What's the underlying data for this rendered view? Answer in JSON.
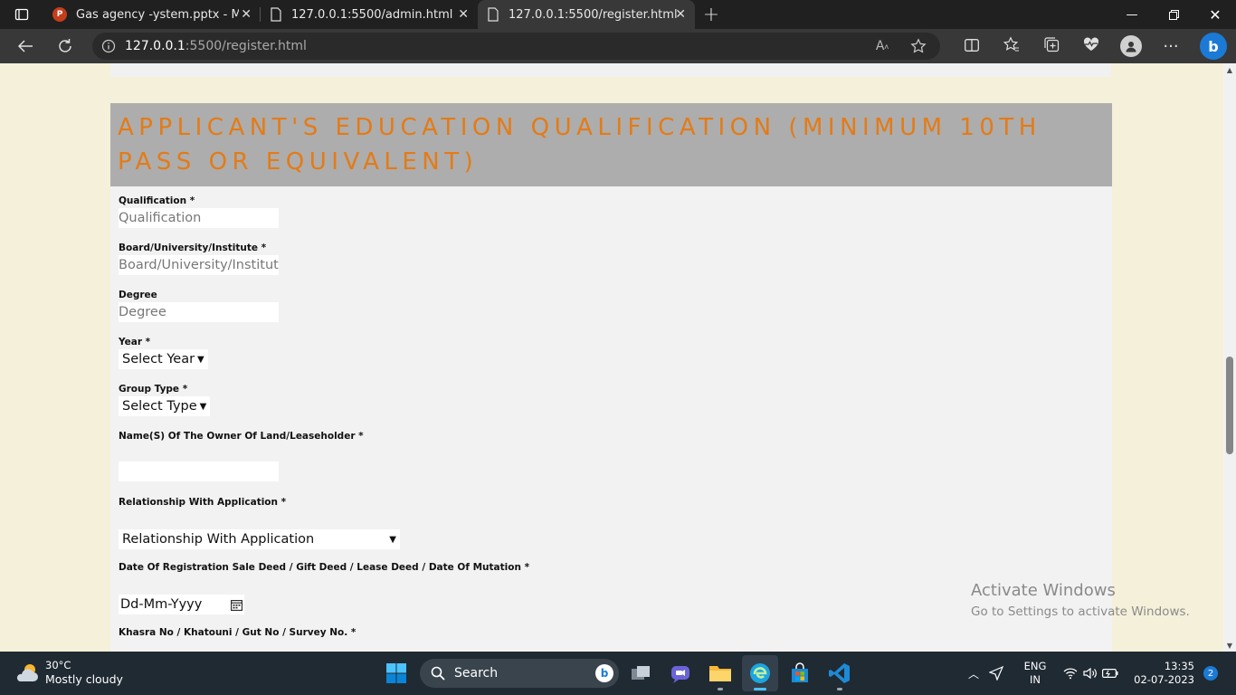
{
  "tabs": [
    {
      "title": "Gas agency -ystem.pptx - Micros",
      "icon": "powerpoint-icon",
      "active": false
    },
    {
      "title": "127.0.0.1:5500/admin.html",
      "icon": "page-icon",
      "active": false
    },
    {
      "title": "127.0.0.1:5500/register.html",
      "icon": "page-icon",
      "active": true
    }
  ],
  "address_bar": {
    "host": "127.0.0.1",
    "path": ":5500/register.html"
  },
  "section": {
    "heading": "Applicant's Education Qualification (Minimum 10th Pass Or Equivalent)"
  },
  "form": {
    "qualification": {
      "label": "Qualification *",
      "placeholder": "Qualification"
    },
    "board": {
      "label": "Board/University/Institute *",
      "placeholder": "Board/University/Institute"
    },
    "degree": {
      "label": "Degree",
      "placeholder": "Degree"
    },
    "year": {
      "label": "Year *",
      "selected": "Select Year"
    },
    "group_type": {
      "label": "Group Type *",
      "selected": "Select Type"
    },
    "owner": {
      "label": "Name(S) Of The Owner Of Land/Leaseholder *",
      "value": ""
    },
    "relationship": {
      "label": "Relationship With Application *",
      "selected": "Relationship With Application"
    },
    "registration_date": {
      "label": "Date Of Registration Sale Deed / Gift Deed / Lease Deed / Date Of Mutation *",
      "placeholder": "Dd-Mm-Yyyy"
    },
    "khasra": {
      "label": "Khasra No / Khatouni / Gut No / Survey No. *",
      "value": ""
    }
  },
  "watermark": {
    "line1": "Activate Windows",
    "line2": "Go to Settings to activate Windows."
  },
  "taskbar": {
    "weather": {
      "temp": "30°C",
      "desc": "Mostly cloudy"
    },
    "search_label": "Search",
    "lang": {
      "line1": "ENG",
      "line2": "IN"
    },
    "time": "13:35",
    "date": "02-07-2023",
    "notifications": "2"
  },
  "colors": {
    "heading": "#e47b16",
    "heading_bg": "#adadad",
    "page_bg": "#f5f0d9",
    "card_bg": "#f2f2f2"
  }
}
